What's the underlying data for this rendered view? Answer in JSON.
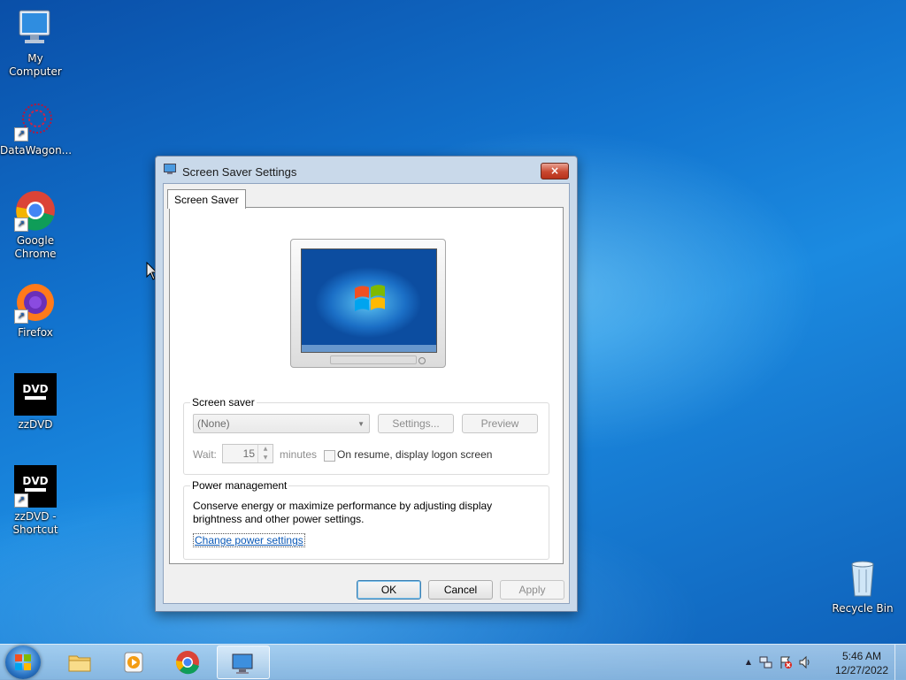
{
  "desktop": {
    "icons": [
      {
        "label": "My Computer"
      },
      {
        "label": "DataWagon..."
      },
      {
        "label": "Google\nChrome"
      },
      {
        "label": "Firefox"
      },
      {
        "label": "zzDVD"
      },
      {
        "label": "zzDVD -\nShortcut"
      },
      {
        "label": "Recycle Bin"
      }
    ]
  },
  "dialog": {
    "title": "Screen Saver Settings",
    "close_icon": "×",
    "tab_label": "Screen Saver",
    "screen_saver": {
      "group_title": "Screen saver",
      "selected": "(None)",
      "settings_label": "Settings...",
      "preview_label": "Preview",
      "wait_label": "Wait:",
      "wait_value": "15",
      "minutes_label": "minutes",
      "resume_label": "On resume, display logon screen"
    },
    "power": {
      "group_title": "Power management",
      "description": "Conserve energy or maximize performance by adjusting display brightness and other power settings.",
      "link": "Change power settings"
    },
    "buttons": {
      "ok": "OK",
      "cancel": "Cancel",
      "apply": "Apply"
    }
  },
  "taskbar": {
    "clock_time": "5:46 AM",
    "clock_date": "12/27/2022",
    "tray_arrow": "▲"
  }
}
